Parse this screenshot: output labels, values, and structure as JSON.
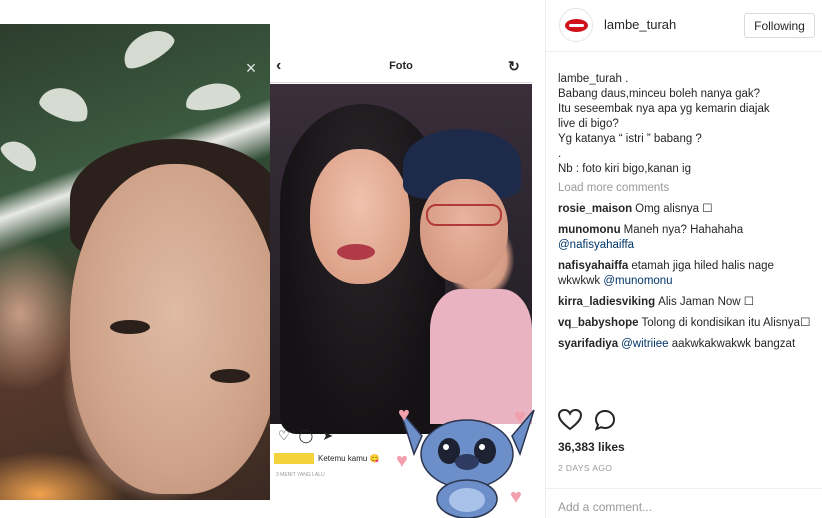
{
  "left_photo": {
    "close_icon": "close-icon"
  },
  "phone": {
    "header_title": "Foto",
    "back_icon": "back-arrow-icon",
    "refresh_icon": "refresh-icon",
    "caption_text": "Ketemu kamu 😋",
    "time_text": "3 MENIT YANG LALU"
  },
  "post": {
    "username": "lambe_turah",
    "follow_label": "Following",
    "caption_lines": [
      "lambe_turah .",
      "Babang daus,minceu boleh nanya gak?",
      "Itu seseembak nya apa yg kemarin diajak",
      "live di bigo?",
      "Yg katanya “ istri ” babang ?",
      ".",
      "Nb : foto kiri bigo,kanan ig"
    ],
    "load_more": "Load more comments",
    "comments": [
      {
        "user": "rosie_maison",
        "text": "Omg alisnya ☐",
        "mention": ""
      },
      {
        "user": "munomonu",
        "text": "Maneh nya? Hahahaha",
        "mention": "@nafisyahaiffa"
      },
      {
        "user": "nafisyahaiffa",
        "text": "etamah jiga hiled halis nage wkwkwk",
        "mention": "@munomonu"
      },
      {
        "user": "kirra_ladiesviking",
        "text": "Alis Jaman Now ☐",
        "mention": ""
      },
      {
        "user": "vq_babyshope",
        "text": "Tolong di kondisikan itu Alisnya☐",
        "mention": ""
      },
      {
        "user": "syarifadiya",
        "text": "aakwkakwakwk bangzat",
        "mention": "@witriiee"
      }
    ],
    "likes": "36,383 likes",
    "time_ago": "2 DAYS AGO",
    "add_comment_placeholder": "Add a comment..."
  },
  "colors": {
    "link": "#003569",
    "muted": "#999999",
    "brand_red": "#d0131b"
  }
}
